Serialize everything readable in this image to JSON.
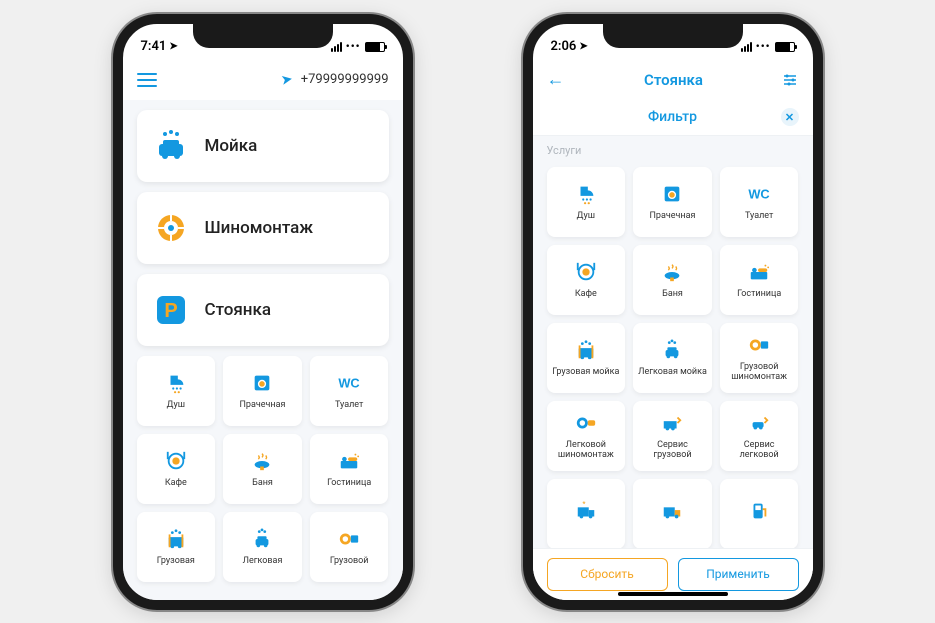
{
  "phone1": {
    "status_time": "7:41",
    "phone_number": "+79999999999",
    "big_cards": [
      {
        "icon": "carwash",
        "label": "Мойка"
      },
      {
        "icon": "tire",
        "label": "Шиномонтаж"
      },
      {
        "icon": "parking",
        "label": "Стоянка"
      }
    ],
    "tiles": [
      {
        "icon": "shower",
        "label": "Душ"
      },
      {
        "icon": "laundry",
        "label": "Прачечная"
      },
      {
        "icon": "wc",
        "label": "Туалет"
      },
      {
        "icon": "cafe",
        "label": "Кафе"
      },
      {
        "icon": "sauna",
        "label": "Баня"
      },
      {
        "icon": "hotel",
        "label": "Гостиница"
      },
      {
        "icon": "truckwash",
        "label": "Грузовая"
      },
      {
        "icon": "carwash2",
        "label": "Легковая"
      },
      {
        "icon": "trucktire",
        "label": "Грузовой"
      }
    ]
  },
  "phone2": {
    "status_time": "2:06",
    "title": "Стоянка",
    "filter_label": "Фильтр",
    "section_label": "Услуги",
    "reset_label": "Сбросить",
    "apply_label": "Применить",
    "tiles": [
      {
        "icon": "shower",
        "label": "Душ"
      },
      {
        "icon": "laundry",
        "label": "Прачечная"
      },
      {
        "icon": "wc",
        "label": "Туалет"
      },
      {
        "icon": "cafe",
        "label": "Кафе"
      },
      {
        "icon": "sauna",
        "label": "Баня"
      },
      {
        "icon": "hotel",
        "label": "Гостиница"
      },
      {
        "icon": "truckwash",
        "label": "Грузовая мойка"
      },
      {
        "icon": "carwash2",
        "label": "Легковая мойка"
      },
      {
        "icon": "trucktire",
        "label": "Грузовой шиномонтаж"
      },
      {
        "icon": "cartire",
        "label": "Легковой шиномонтаж"
      },
      {
        "icon": "trucksvc",
        "label": "Сервис грузовой"
      },
      {
        "icon": "carsvc",
        "label": "Сервис легковой"
      },
      {
        "icon": "reftruck",
        "label": ""
      },
      {
        "icon": "truck",
        "label": ""
      },
      {
        "icon": "gas",
        "label": ""
      }
    ]
  }
}
